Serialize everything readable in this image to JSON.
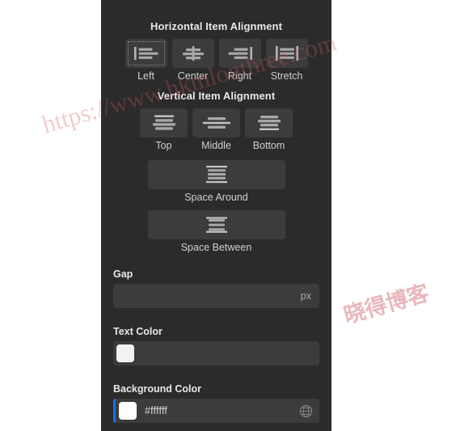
{
  "panel": {
    "background_color": "#2b2b2b",
    "button_color": "#3c3c3c",
    "accent_color": "#1473e6"
  },
  "horizontal_alignment": {
    "title": "Horizontal Item Alignment",
    "buttons": [
      {
        "label": "Left",
        "icon": "align-left-icon",
        "focused": true
      },
      {
        "label": "Center",
        "icon": "align-center-icon",
        "focused": false
      },
      {
        "label": "Right",
        "icon": "align-right-icon",
        "focused": false
      },
      {
        "label": "Stretch",
        "icon": "align-stretch-icon",
        "focused": false
      }
    ]
  },
  "vertical_alignment": {
    "title": "Vertical Item Alignment",
    "buttons": [
      {
        "label": "Top",
        "icon": "align-top-icon",
        "focused": false
      },
      {
        "label": "Middle",
        "icon": "align-middle-icon",
        "focused": false
      },
      {
        "label": "Bottom",
        "icon": "align-bottom-icon",
        "focused": false
      }
    ],
    "wide_buttons": [
      {
        "label": "Space Around",
        "icon": "space-around-icon"
      },
      {
        "label": "Space Between",
        "icon": "space-between-icon"
      }
    ]
  },
  "gap": {
    "label": "Gap",
    "value": "",
    "placeholder": "",
    "unit": "px"
  },
  "text_color": {
    "label": "Text Color",
    "value": "",
    "swatch": "#f2f2f2"
  },
  "background_color": {
    "label": "Background Color",
    "value": "#ffffff",
    "swatch": "#ffffff",
    "picker_icon": "globe-icon",
    "focused": true
  },
  "watermarks": {
    "url": "https://www.hkmlonthree.com",
    "cn": "晓得博客"
  }
}
